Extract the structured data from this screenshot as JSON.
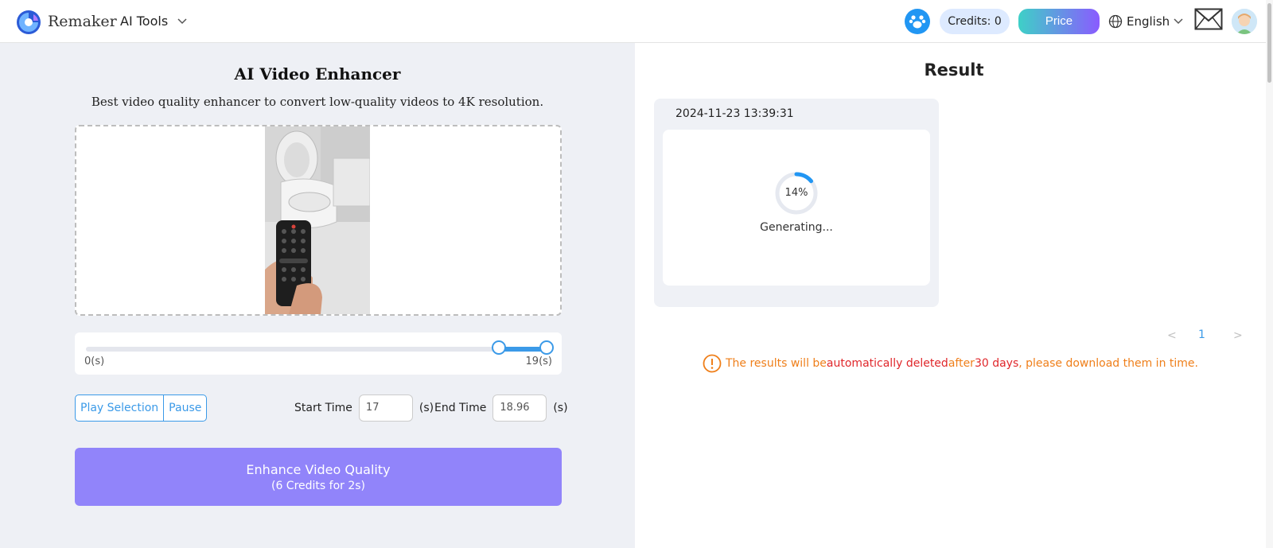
{
  "header": {
    "brand": "Remaker",
    "ai_tools": "AI Tools",
    "credits": "Credits: 0",
    "price": "Price",
    "language": "English"
  },
  "left": {
    "title": "AI Video Enhancer",
    "subtitle": "Best video quality enhancer to convert low-quality videos to 4K resolution.",
    "timeline": {
      "start_label": "0(s)",
      "end_label": "19(s)",
      "duration": 19,
      "selection_start": 17,
      "selection_end": 18.96
    },
    "play_selection": "Play Selection",
    "pause": "Pause",
    "start_time_label": "Start Time",
    "start_time_value": "17",
    "end_time_label": "End Time",
    "end_time_value": "18.96",
    "unit": "(s)",
    "enhance_line1": "Enhance Video Quality",
    "enhance_line2": "(6 Credits for 2s)"
  },
  "right": {
    "title": "Result",
    "card": {
      "timestamp": "2024-11-23 13:39:31",
      "progress_text": "14%",
      "progress_value": 0.14,
      "status": "Generating..."
    },
    "pager": {
      "current": "1",
      "prev": "<",
      "next": ">"
    },
    "notice": {
      "part1": "The results will be ",
      "part2": "automatically deleted",
      "part3": " after ",
      "part4": "30 days",
      "part5": ", please download them in time."
    }
  },
  "colors": {
    "accent": "#3b9ae8",
    "enhance_button": "#9184fa",
    "left_bg": "#eef0f5",
    "warning": "#ef7f1a",
    "danger": "#e0272b"
  },
  "icons": {
    "logo": "remaker-logo-icon",
    "community": "community-icon",
    "globe": "globe-icon",
    "mail": "mail-icon",
    "avatar": "avatar-icon",
    "warning": "warning-icon"
  }
}
